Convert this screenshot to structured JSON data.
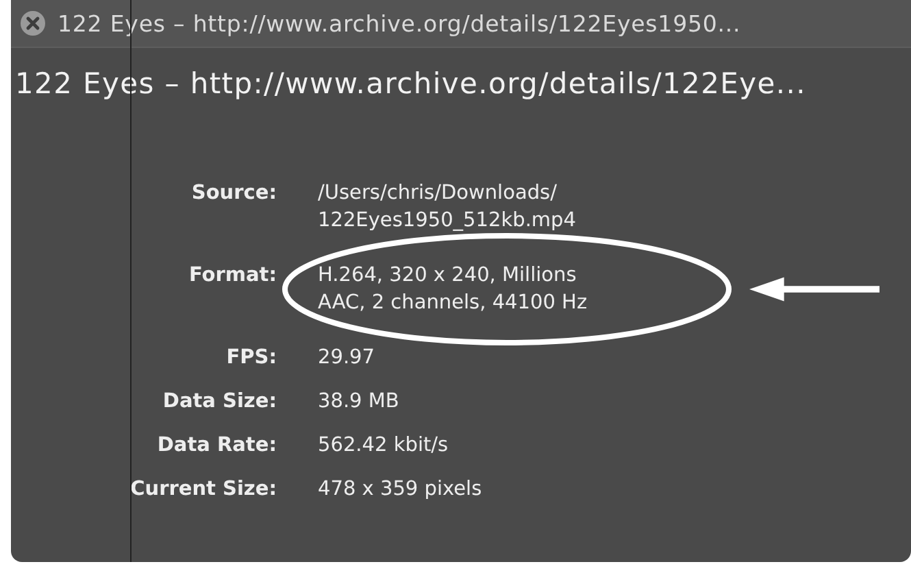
{
  "window": {
    "title": "122 Eyes – http://www.archive.org/details/122Eyes1950..."
  },
  "heading": "122 Eyes – http://www.archive.org/details/122Eye...",
  "info": [
    {
      "label": "Source:",
      "value": "/Users/chris/Downloads/\n122Eyes1950_512kb.mp4",
      "highlighted": false
    },
    {
      "label": "Format:",
      "value": "H.264, 320 x 240, Millions\nAAC, 2 channels, 44100 Hz",
      "highlighted": true
    },
    {
      "label": "FPS:",
      "value": "29.97",
      "highlighted": false
    },
    {
      "label": "Data Size:",
      "value": "38.9 MB",
      "highlighted": false
    },
    {
      "label": "Data Rate:",
      "value": "562.42 kbit/s",
      "highlighted": false
    },
    {
      "label": "Current Size:",
      "value": "478 x 359 pixels",
      "highlighted": false
    }
  ]
}
